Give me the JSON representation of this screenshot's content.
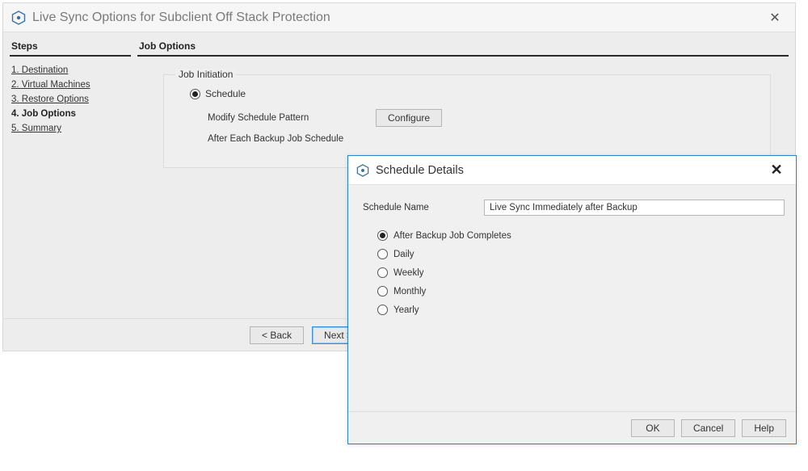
{
  "window": {
    "title": "Live Sync Options for Subclient Off Stack Protection",
    "close_glyph": "✕"
  },
  "steps": {
    "header": "Steps",
    "items": [
      {
        "label": "1. Destination",
        "current": false
      },
      {
        "label": "2. Virtual Machines",
        "current": false
      },
      {
        "label": "3. Restore Options",
        "current": false
      },
      {
        "label": "4. Job Options",
        "current": true
      },
      {
        "label": "5. Summary",
        "current": false
      }
    ]
  },
  "content": {
    "header": "Job Options",
    "group_label": "Job Initiation",
    "schedule_radio_label": "Schedule",
    "modify_pattern_label": "Modify Schedule Pattern",
    "after_each_label": "After Each Backup Job Schedule",
    "configure_btn": "Configure"
  },
  "footer": {
    "back": "< Back",
    "next": "Next >"
  },
  "modal": {
    "title": "Schedule Details",
    "close_glyph": "✕",
    "name_label": "Schedule Name",
    "name_value": "Live Sync Immediately after Backup",
    "options": [
      {
        "label": "After Backup Job Completes",
        "selected": true
      },
      {
        "label": "Daily",
        "selected": false
      },
      {
        "label": "Weekly",
        "selected": false
      },
      {
        "label": "Monthly",
        "selected": false
      },
      {
        "label": "Yearly",
        "selected": false
      }
    ],
    "ok": "OK",
    "cancel": "Cancel",
    "help": "Help"
  }
}
